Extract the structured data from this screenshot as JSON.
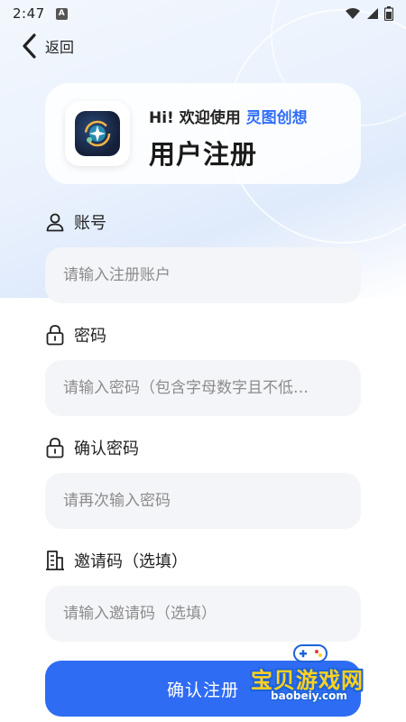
{
  "status_bar": {
    "time": "2:47",
    "badge": "A"
  },
  "nav": {
    "back_label": "返回"
  },
  "header": {
    "greeting": "Hi! 欢迎使用",
    "brand": "灵图创想",
    "title": "用户注册"
  },
  "form": {
    "account": {
      "label": "账号",
      "placeholder": "请输入注册账户",
      "value": ""
    },
    "password": {
      "label": "密码",
      "placeholder": "请输入密码（包含字母数字且不低…",
      "value": ""
    },
    "confirm_password": {
      "label": "确认密码",
      "placeholder": "请再次输入密码",
      "value": ""
    },
    "invite_code": {
      "label": "邀请码（选填）",
      "placeholder": "请输入邀请码（选填）",
      "value": ""
    },
    "submit_label": "确认注册"
  },
  "watermark": {
    "title": "宝贝游戏网",
    "subtitle": "baobeiy.com"
  },
  "colors": {
    "accent": "#2f6cf4",
    "brand_text": "#2f6df6",
    "input_bg": "#f4f5f8"
  },
  "icons": {
    "back": "chevron-left-icon",
    "account": "user-icon",
    "password": "lock-icon",
    "confirm_password": "lock-icon",
    "invite_code": "building-icon"
  }
}
